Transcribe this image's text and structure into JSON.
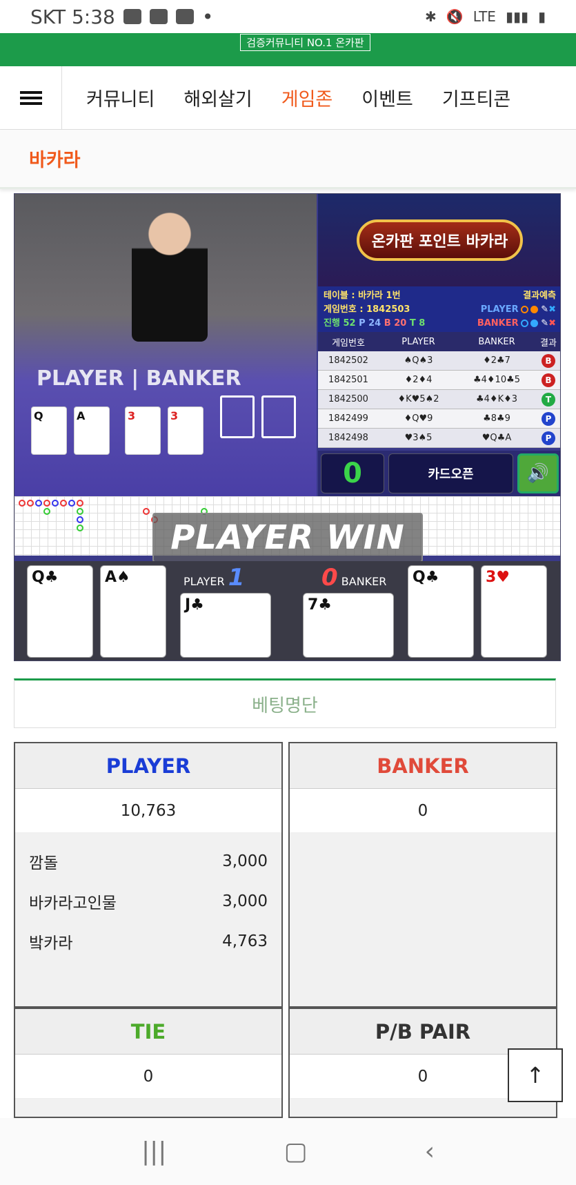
{
  "status": {
    "carrier_time": "SKT 5:38",
    "network": "LTE"
  },
  "header": {
    "logo_sub": "검증커뮤니티 NO.1 온카판"
  },
  "nav": {
    "items": [
      "커뮤니티",
      "해외살기",
      "게임존",
      "이벤트",
      "기프티콘"
    ],
    "active": "게임존"
  },
  "page": {
    "title": "바카라"
  },
  "game": {
    "table_overlay": "PLAYER | BANKER",
    "promo_title": "온카판 포인트 바카라",
    "info": {
      "table": "테이블 : 바카라 1번",
      "prediction_label": "결과예측",
      "round": "게임번호 : 1842503",
      "progress": "진행 52",
      "p_count": "P 24",
      "b_count": "B 20",
      "t_count": "T 8",
      "player_label": "PLAYER",
      "banker_label": "BANKER"
    },
    "history_headers": [
      "게임번호",
      "PLAYER",
      "BANKER",
      "결과"
    ],
    "history": [
      {
        "id": "1842502",
        "player": "♠Q♠3",
        "banker": "♦2♣7",
        "result": "B"
      },
      {
        "id": "1842501",
        "player": "♦2♦4",
        "banker": "♣4♦10♣5",
        "result": "B"
      },
      {
        "id": "1842500",
        "player": "♦K♥5♠2",
        "banker": "♣4♦K♦3",
        "result": "T"
      },
      {
        "id": "1842499",
        "player": "♦Q♥9",
        "banker": "♣8♣9",
        "result": "P"
      },
      {
        "id": "1842498",
        "player": "♥3♠5",
        "banker": "♥Q♣A",
        "result": "P"
      }
    ],
    "counter": "0",
    "card_open": "카드오픈",
    "banner": "PLAYER WIN",
    "player_label": "PLAYER",
    "player_score": "1",
    "banker_label": "BANKER",
    "banker_score": "0",
    "player_cards": [
      "Q♣",
      "A♠",
      "J♣"
    ],
    "banker_cards": [
      "7♣",
      "Q♣",
      "3♥"
    ]
  },
  "bets": {
    "title": "베팅명단",
    "player": {
      "label": "PLAYER",
      "total": "10,763",
      "rows": [
        {
          "name": "깜돌",
          "amount": "3,000"
        },
        {
          "name": "바카라고인물",
          "amount": "3,000"
        },
        {
          "name": "밬카라",
          "amount": "4,763"
        }
      ]
    },
    "banker": {
      "label": "BANKER",
      "total": "0"
    },
    "tie": {
      "label": "TIE",
      "total": "0"
    },
    "pair": {
      "label": "P/B PAIR",
      "total": "0"
    }
  },
  "colors": {
    "brand_green": "#1c9b4a",
    "accent_orange": "#f05a1c",
    "player_blue": "#1a3dd6",
    "banker_red": "#e04a3a",
    "tie_green": "#4caa2a"
  },
  "icons": [
    "menu-icon",
    "scroll-top-icon",
    "sound-icon",
    "recent-apps-icon",
    "home-icon",
    "back-icon"
  ]
}
